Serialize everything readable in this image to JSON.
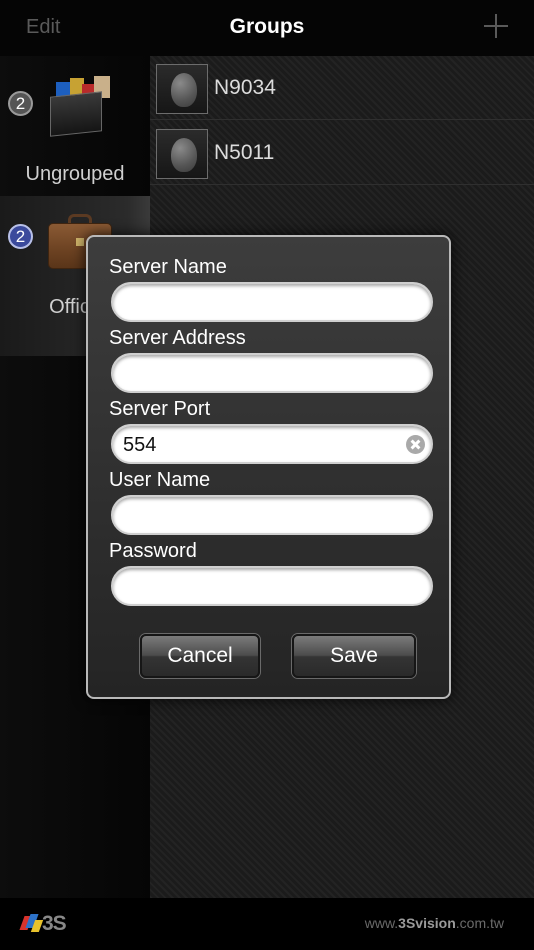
{
  "topbar": {
    "edit_label": "Edit",
    "title": "Groups",
    "add_icon": "plus-icon"
  },
  "groups": [
    {
      "count": "2",
      "label": "Ungrouped",
      "icon": "box-icon",
      "badge_color": "#555555"
    },
    {
      "count": "2",
      "label": "Office",
      "icon": "briefcase-icon",
      "badge_color": "#3b4a9c"
    }
  ],
  "devices": [
    {
      "name": "N9034",
      "icon": "camera-dome-icon"
    },
    {
      "name": "N5011",
      "icon": "camera-dome-icon"
    }
  ],
  "dialog": {
    "fields": [
      {
        "label": "Server Name",
        "value": ""
      },
      {
        "label": "Server Address",
        "value": ""
      },
      {
        "label": "Server Port",
        "value": "554"
      },
      {
        "label": "User Name",
        "value": ""
      },
      {
        "label": "Password",
        "value": ""
      }
    ],
    "cancel_label": "Cancel",
    "save_label": "Save"
  },
  "footer": {
    "logo_text": "3S",
    "url_prefix": "www.",
    "url_brand": "3Svision",
    "url_suffix": ".com.tw"
  }
}
